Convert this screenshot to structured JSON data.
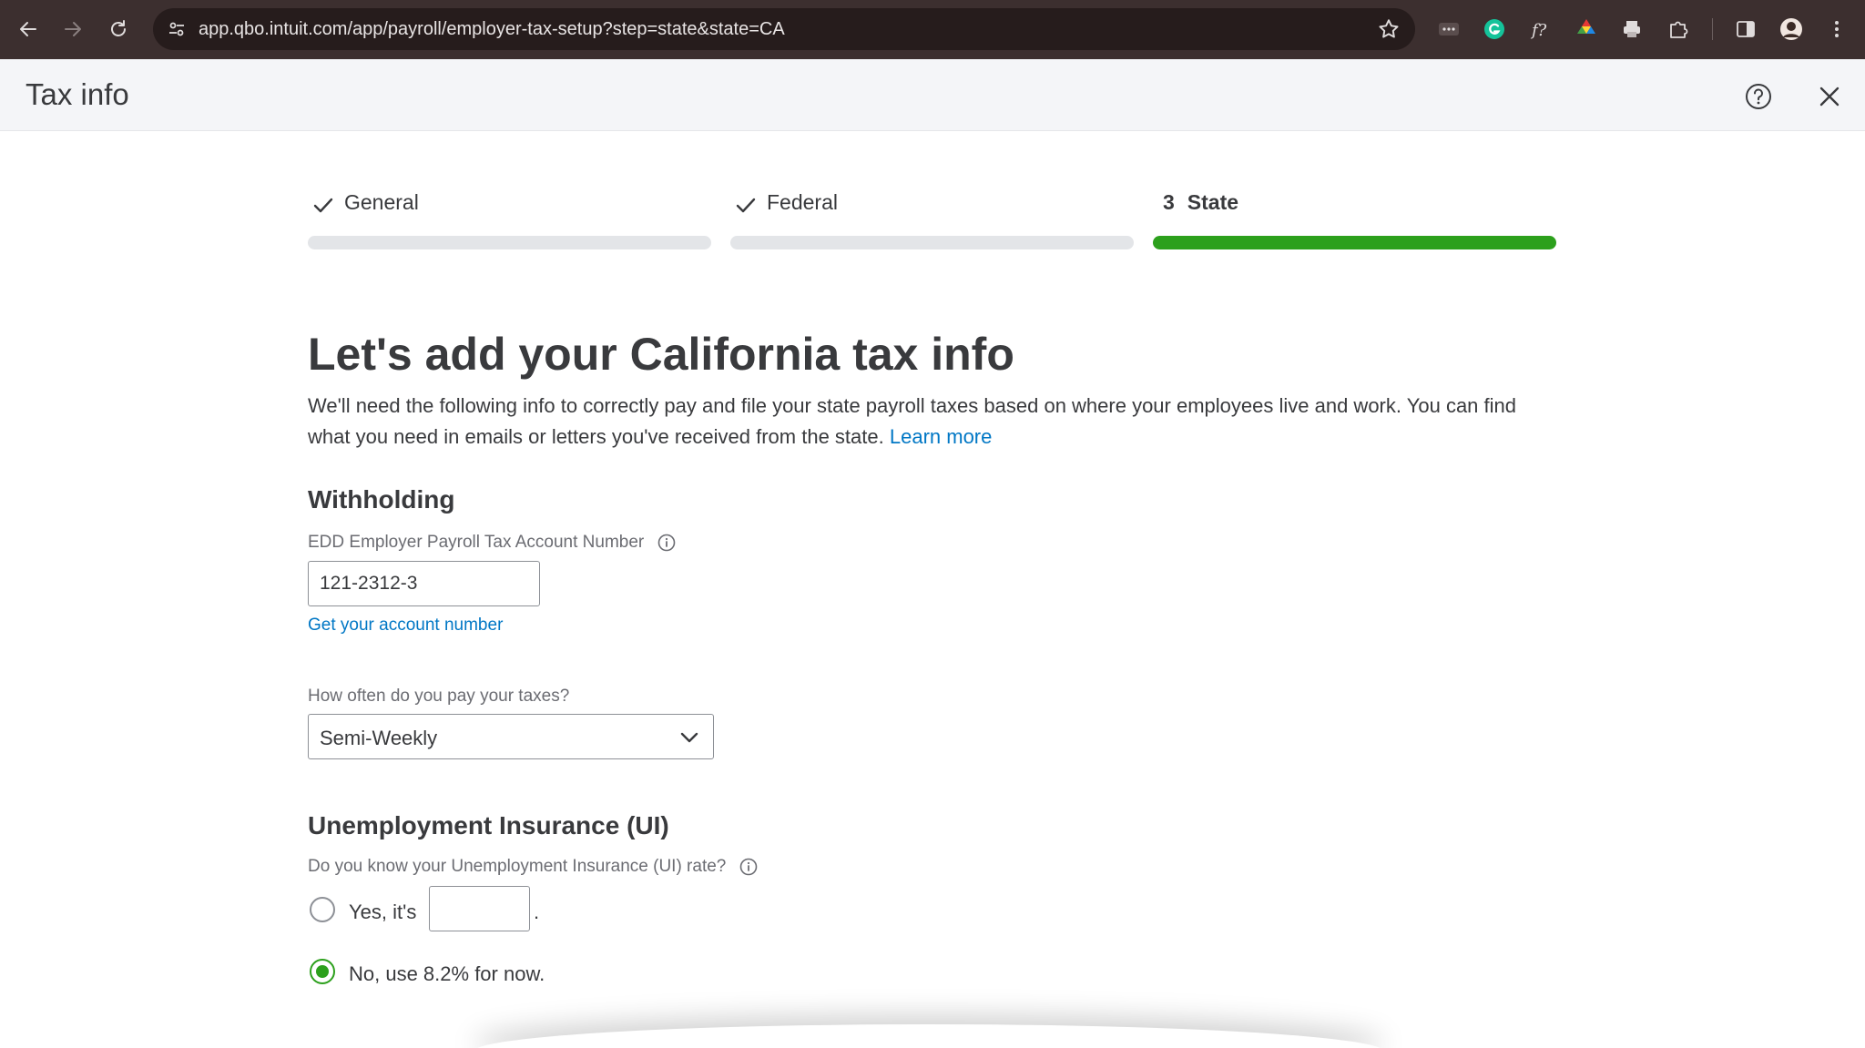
{
  "browser": {
    "url": "app.qbo.intuit.com/app/payroll/employer-tax-setup?step=state&state=CA"
  },
  "header": {
    "title": "Tax info"
  },
  "stepper": {
    "steps": [
      {
        "label": "General",
        "status": "complete"
      },
      {
        "label": "Federal",
        "status": "complete"
      },
      {
        "number": "3",
        "label": "State",
        "status": "active"
      }
    ],
    "active_color": "#2ca01c",
    "inactive_color": "#e3e5e8"
  },
  "main": {
    "heading": "Let's add your California tax info",
    "description": "We'll need the following info to correctly pay and file your state payroll taxes based on where your employees live and work. You can find what you need in emails or letters you've received from the state. ",
    "learn_more": "Learn more",
    "withholding": {
      "heading": "Withholding",
      "account_label": "EDD Employer Payroll Tax Account Number",
      "account_value": "121-2312-3",
      "account_link": "Get your account number",
      "frequency_label": "How often do you pay your taxes?",
      "frequency_value": "Semi-Weekly"
    },
    "unemployment": {
      "heading": "Unemployment Insurance (UI)",
      "rate_question": "Do you know your Unemployment Insurance (UI) rate?",
      "option_yes": "Yes, it's",
      "option_yes_value": "",
      "option_yes_suffix": ".",
      "option_no": "No, use 8.2% for now.",
      "selected": "no"
    }
  },
  "colors": {
    "brand_green": "#2ca01c",
    "link_blue": "#0077c5",
    "text": "#393a3d"
  }
}
